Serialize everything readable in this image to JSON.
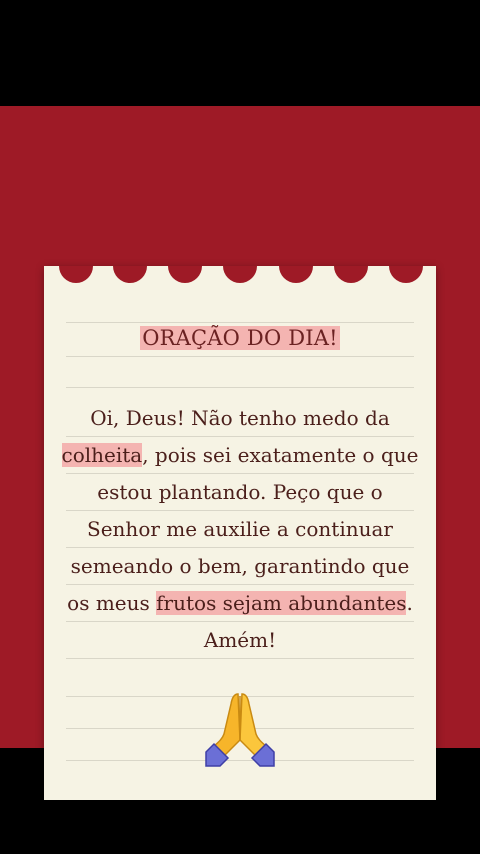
{
  "card": {
    "title": "ORAÇÃO DO DIA!",
    "body": {
      "p1": "Oi, Deus! Não tenho medo da ",
      "h1": "colheita",
      "p2": ", pois sei exatamente o que estou plantando. Peço que o Senhor me auxilie a continuar semeando o bem, garantindo que os meus ",
      "h2": "frutos sejam abundantes",
      "p3": ". Amém!"
    },
    "icon": "folded-hands-icon"
  },
  "colors": {
    "background": "#9e1a26",
    "paper": "#f6f3e4",
    "highlight": "#f4b4b1",
    "text": "#4b1f1b"
  }
}
